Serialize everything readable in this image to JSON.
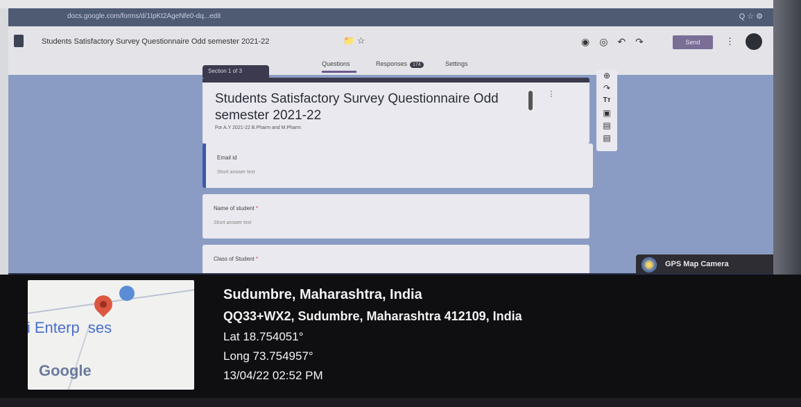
{
  "browser": {
    "url": "docs.google.com/forms/d/1IpKt2AgeNfe0-dq...edit",
    "extension_icons": "Q  ☆  ⚙"
  },
  "forms": {
    "title": "Students Satisfactory Survey Questionnaire Odd semester 2021-22",
    "send_label": "Send",
    "tabs": {
      "questions": "Questions",
      "responses": "Responses",
      "responses_count": "174",
      "settings": "Settings"
    }
  },
  "form": {
    "section_label": "Section 1 of 3",
    "title": "Students Satisfactory Survey Questionnaire Odd semester 2021-22",
    "description": "For A.Y 2021-22 B.Pharm and M.Pharm",
    "questions": [
      {
        "label": "Email id",
        "hint": "Short answer text",
        "required": ""
      },
      {
        "label": "Name of student",
        "hint": "Short answer text",
        "required": "*"
      },
      {
        "label": "Class of Student",
        "hint": "",
        "required": "*"
      }
    ]
  },
  "gps_badge": {
    "label": "GPS Map Camera"
  },
  "overlay": {
    "map_label": "li Enterp  ses",
    "map_brand": "Google",
    "place": "Sudumbre, Maharashtra, India",
    "address": "QQ33+WX2, Sudumbre, Maharashtra 412109, India",
    "lat": "Lat 18.754051°",
    "long": "Long 73.754957°",
    "datetime": "13/04/22 02:52 PM"
  },
  "colors": {
    "accent": "#3b3a4e",
    "active_border": "#3e59a8",
    "overlay_bg": "#0f0f12"
  }
}
